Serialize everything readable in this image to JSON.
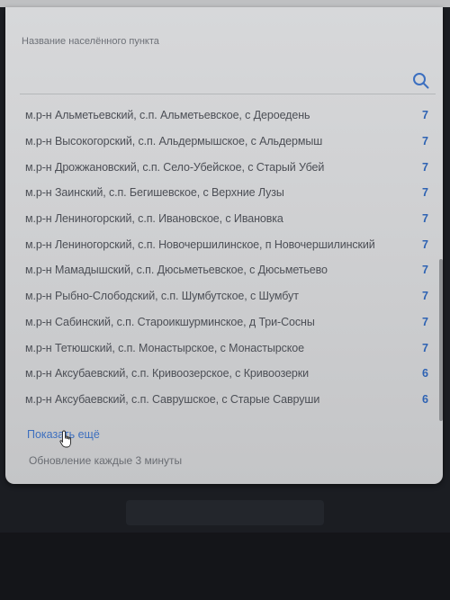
{
  "search": {
    "label": "Название населённого пункта",
    "value": ""
  },
  "results": [
    {
      "name": "м.р-н Альметьевский, с.п. Альметьевское, с Дероедень",
      "count": "7"
    },
    {
      "name": "м.р-н Высокогорский, с.п. Альдермышское, с Альдермыш",
      "count": "7"
    },
    {
      "name": "м.р-н Дрожжановский, с.п. Село-Убейское, с Старый Убей",
      "count": "7"
    },
    {
      "name": "м.р-н Заинский, с.п. Бегишевское, с Верхние Лузы",
      "count": "7"
    },
    {
      "name": "м.р-н Лениногорский, с.п. Ивановское, с Ивановка",
      "count": "7"
    },
    {
      "name": "м.р-н Лениногорский, с.п. Новочершилинское, п Новочершилинский",
      "count": "7"
    },
    {
      "name": "м.р-н Мамадышский, с.п. Дюсьметьевское, с Дюсьметьево",
      "count": "7"
    },
    {
      "name": "м.р-н Рыбно-Слободский, с.п. Шумбутское, с Шумбут",
      "count": "7"
    },
    {
      "name": "м.р-н Сабинский, с.п. Староикшурминское, д Три-Сосны",
      "count": "7"
    },
    {
      "name": "м.р-н Тетюшский, с.п. Монастырское, с Монастырское",
      "count": "7"
    },
    {
      "name": "м.р-н Аксубаевский, с.п. Кривоозерское, с Кривоозерки",
      "count": "6"
    },
    {
      "name": "м.р-н Аксубаевский, с.п. Саврушское, с Старые Савруши",
      "count": "6"
    }
  ],
  "show_more_label": "Показать ещё",
  "update_note": "Обновление каждые 3 минуты",
  "colors": {
    "accent": "#2d62b3",
    "panel": "#d3d4d6"
  },
  "icons": {
    "search": "search-icon",
    "cursor": "hand-cursor-icon"
  }
}
